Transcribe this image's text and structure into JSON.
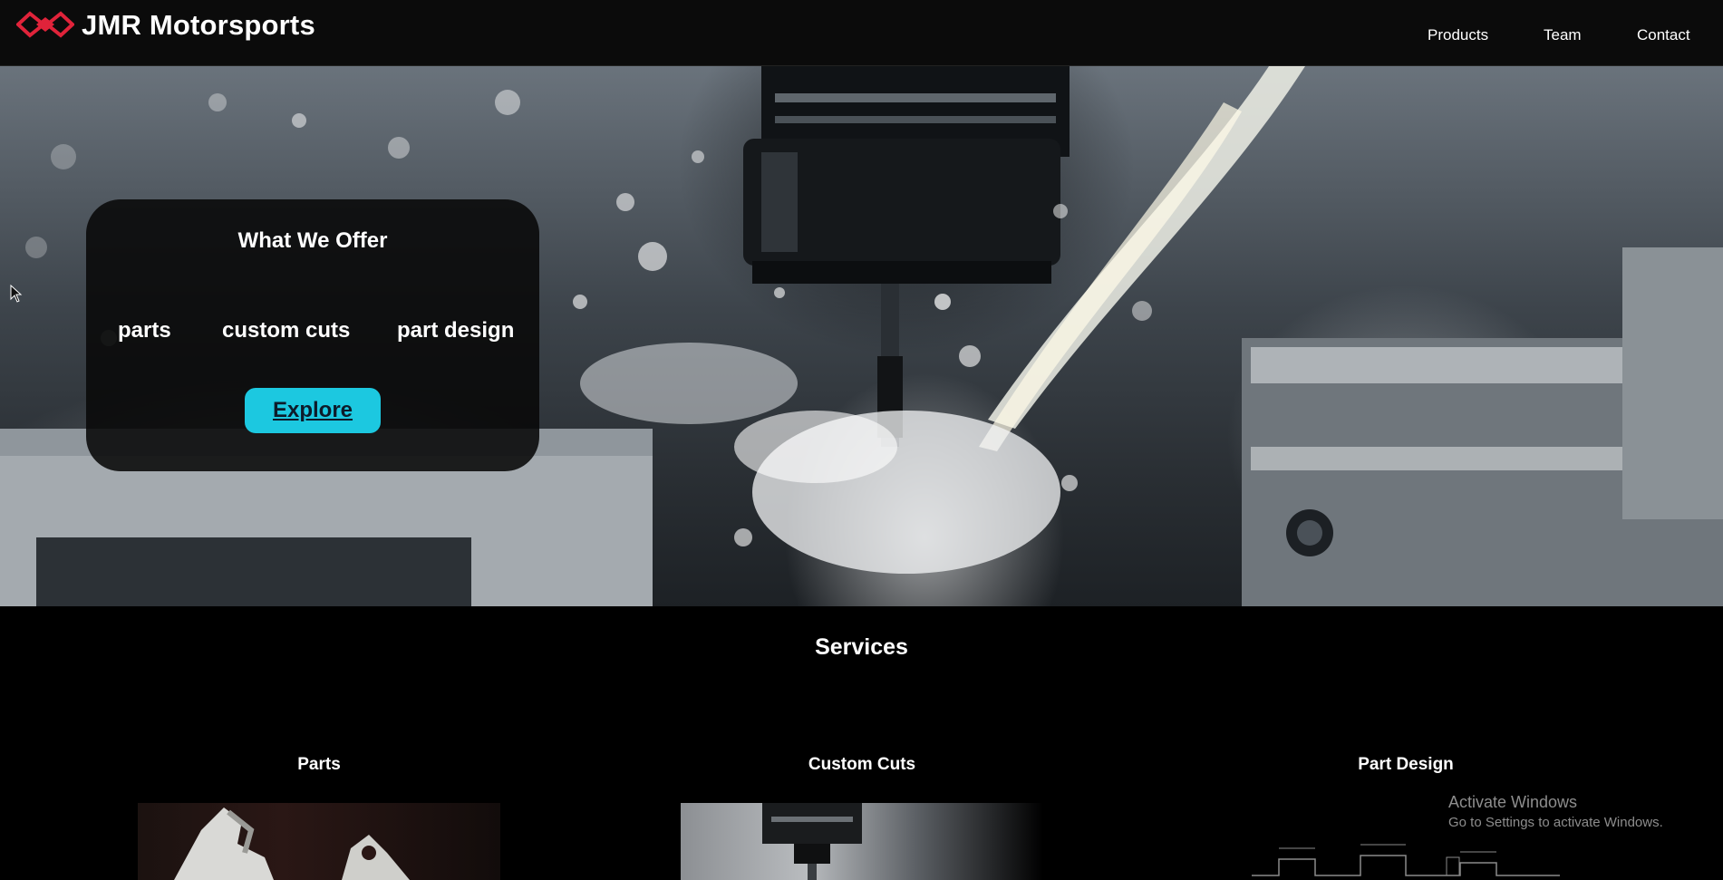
{
  "brand": {
    "name": "JMR Motorsports",
    "logo_icon": "chain-link-logo-icon",
    "accent_color": "#e0233a"
  },
  "nav": {
    "items": [
      {
        "label": "Products"
      },
      {
        "label": "Team"
      },
      {
        "label": "Contact"
      }
    ]
  },
  "hero": {
    "background_image": "cnc-milling-coolant-splash",
    "offer": {
      "title": "What We Offer",
      "items": [
        "parts",
        "custom cuts",
        "part design"
      ],
      "button_label": "Explore",
      "button_color": "#1cc8e0"
    }
  },
  "services": {
    "title": "Services",
    "cards": [
      {
        "title": "Parts",
        "image": "machined-parts-photo"
      },
      {
        "title": "Custom Cuts",
        "image": "cnc-spindle-photo"
      },
      {
        "title": "Part Design",
        "image": "technical-drawing-image"
      }
    ]
  },
  "os_overlay": {
    "title": "Activate Windows",
    "subtitle": "Go to Settings to activate Windows."
  }
}
